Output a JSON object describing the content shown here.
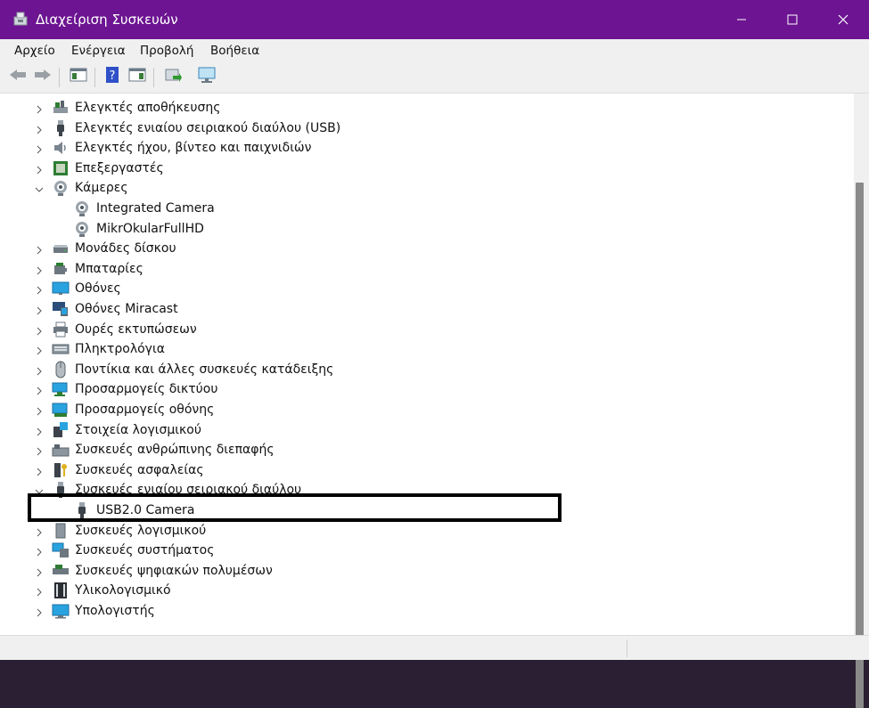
{
  "window": {
    "title": "Διαχείριση Συσκευών",
    "controls": [
      "minimize-icon",
      "maximize-icon",
      "close-icon"
    ],
    "accent": "#6c1491"
  },
  "menu": {
    "items": [
      "Αρχείο",
      "Ενέργεια",
      "Προβολή",
      "Βοήθεια"
    ]
  },
  "toolbar": {
    "buttons": [
      "back-arrow-icon",
      "forward-arrow-icon",
      "properties-pane-icon",
      "help-icon",
      "action-pane-icon",
      "update-driver-icon",
      "scan-hardware-icon"
    ]
  },
  "tree": {
    "items": [
      {
        "label": "Ελεγκτές αποθήκευσης",
        "expanded": false,
        "icon": "storage-controller-icon"
      },
      {
        "label": "Ελεγκτές ενιαίου σειριακού διαύλου (USB)",
        "expanded": false,
        "icon": "usb-plug-icon"
      },
      {
        "label": "Ελεγκτές ήχου, βίντεο και παιχνιδιών",
        "expanded": false,
        "icon": "speaker-icon"
      },
      {
        "label": "Επεξεργαστές",
        "expanded": false,
        "icon": "processor-icon"
      },
      {
        "label": "Κάμερες",
        "expanded": true,
        "icon": "webcam-icon"
      },
      {
        "label": "Integrated Camera",
        "child": true,
        "icon": "webcam-icon"
      },
      {
        "label": "MikrOkularFullHD",
        "child": true,
        "icon": "webcam-icon"
      },
      {
        "label": "Μονάδες δίσκου",
        "expanded": false,
        "icon": "disk-drive-icon"
      },
      {
        "label": "Μπαταρίες",
        "expanded": false,
        "icon": "battery-icon"
      },
      {
        "label": "Οθόνες",
        "expanded": false,
        "icon": "monitor-icon"
      },
      {
        "label": "Οθόνες Miracast",
        "expanded": false,
        "icon": "miracast-icon"
      },
      {
        "label": "Ουρές εκτυπώσεων",
        "expanded": false,
        "icon": "printer-icon"
      },
      {
        "label": "Πληκτρολόγια",
        "expanded": false,
        "icon": "keyboard-icon"
      },
      {
        "label": "Ποντίκια και άλλες συσκευές κατάδειξης",
        "expanded": false,
        "icon": "mouse-icon"
      },
      {
        "label": "Προσαρμογείς δικτύου",
        "expanded": false,
        "icon": "network-adapter-icon"
      },
      {
        "label": "Προσαρμογείς οθόνης",
        "expanded": false,
        "icon": "display-adapter-icon"
      },
      {
        "label": "Στοιχεία λογισμικού",
        "expanded": false,
        "icon": "software-component-icon"
      },
      {
        "label": "Συσκευές ανθρώπινης διεπαφής",
        "expanded": false,
        "icon": "hid-icon"
      },
      {
        "label": "Συσκευές ασφαλείας",
        "expanded": false,
        "icon": "security-key-icon"
      },
      {
        "label": "Συσκευές ενιαίου σειριακού διαύλου",
        "expanded": true,
        "icon": "usb-plug-icon"
      },
      {
        "label": "USB2.0 Camera",
        "child": true,
        "icon": "usb-plug-icon"
      },
      {
        "label": "Συσκευές λογισμικού",
        "expanded": false,
        "icon": "software-device-icon"
      },
      {
        "label": "Συσκευές συστήματος",
        "expanded": false,
        "icon": "system-device-icon"
      },
      {
        "label": "Συσκευές ψηφιακών πολυμέσων",
        "expanded": false,
        "icon": "digital-media-icon"
      },
      {
        "label": "Υλικολογισμικό",
        "expanded": false,
        "icon": "firmware-icon"
      },
      {
        "label": "Υπολογιστής",
        "expanded": false,
        "icon": "computer-icon"
      }
    ]
  }
}
